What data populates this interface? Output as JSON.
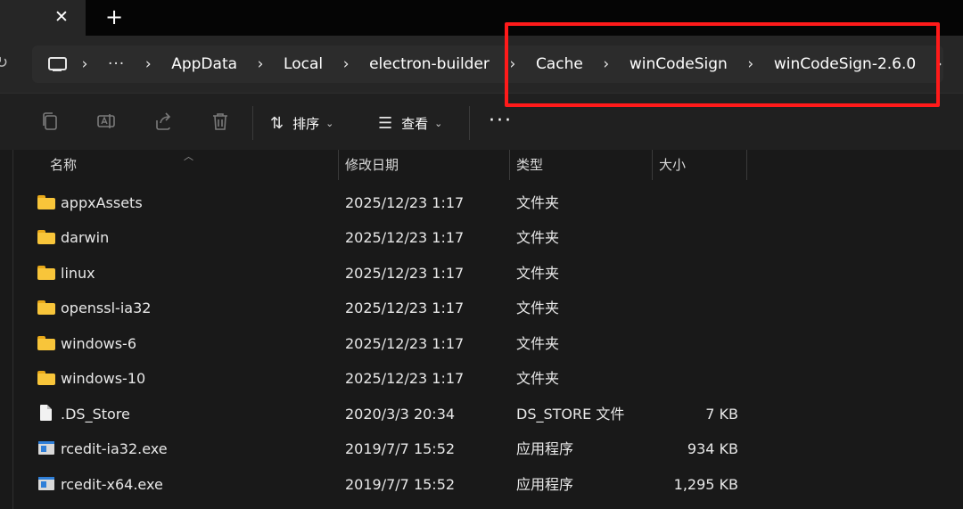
{
  "tabs": {
    "close_glyph": "✕",
    "new_tab_glyph": "+"
  },
  "breadcrumb": {
    "ellipsis": "···",
    "items": [
      "AppData",
      "Local",
      "electron-builder",
      "Cache",
      "winCodeSign",
      "winCodeSign-2.6.0"
    ],
    "separator": "›"
  },
  "toolbar": {
    "icons": [
      "copy-icon",
      "rename-icon",
      "share-icon",
      "delete-icon"
    ],
    "sort_label": "排序",
    "view_label": "查看",
    "more_label": "···"
  },
  "columns": {
    "name": "名称",
    "date": "修改日期",
    "type": "类型",
    "size": "大小"
  },
  "files": [
    {
      "name": "appxAssets",
      "date": "2025/12/23 1:17",
      "type": "文件夹",
      "size": "",
      "icon": "folder-icon"
    },
    {
      "name": "darwin",
      "date": "2025/12/23 1:17",
      "type": "文件夹",
      "size": "",
      "icon": "folder-icon"
    },
    {
      "name": "linux",
      "date": "2025/12/23 1:17",
      "type": "文件夹",
      "size": "",
      "icon": "folder-icon"
    },
    {
      "name": "openssl-ia32",
      "date": "2025/12/23 1:17",
      "type": "文件夹",
      "size": "",
      "icon": "folder-icon"
    },
    {
      "name": "windows-6",
      "date": "2025/12/23 1:17",
      "type": "文件夹",
      "size": "",
      "icon": "folder-icon"
    },
    {
      "name": "windows-10",
      "date": "2025/12/23 1:17",
      "type": "文件夹",
      "size": "",
      "icon": "folder-icon"
    },
    {
      "name": ".DS_Store",
      "date": "2020/3/3 20:34",
      "type": "DS_STORE 文件",
      "size": "7 KB",
      "icon": "file-icon"
    },
    {
      "name": "rcedit-ia32.exe",
      "date": "2019/7/7 15:52",
      "type": "应用程序",
      "size": "934 KB",
      "icon": "exe-icon"
    },
    {
      "name": "rcedit-x64.exe",
      "date": "2019/7/7 15:52",
      "type": "应用程序",
      "size": "1,295 KB",
      "icon": "exe-icon"
    }
  ],
  "colors": {
    "highlight": "#ff1a1a",
    "folder": "#f8c53a",
    "background": "#191919"
  }
}
